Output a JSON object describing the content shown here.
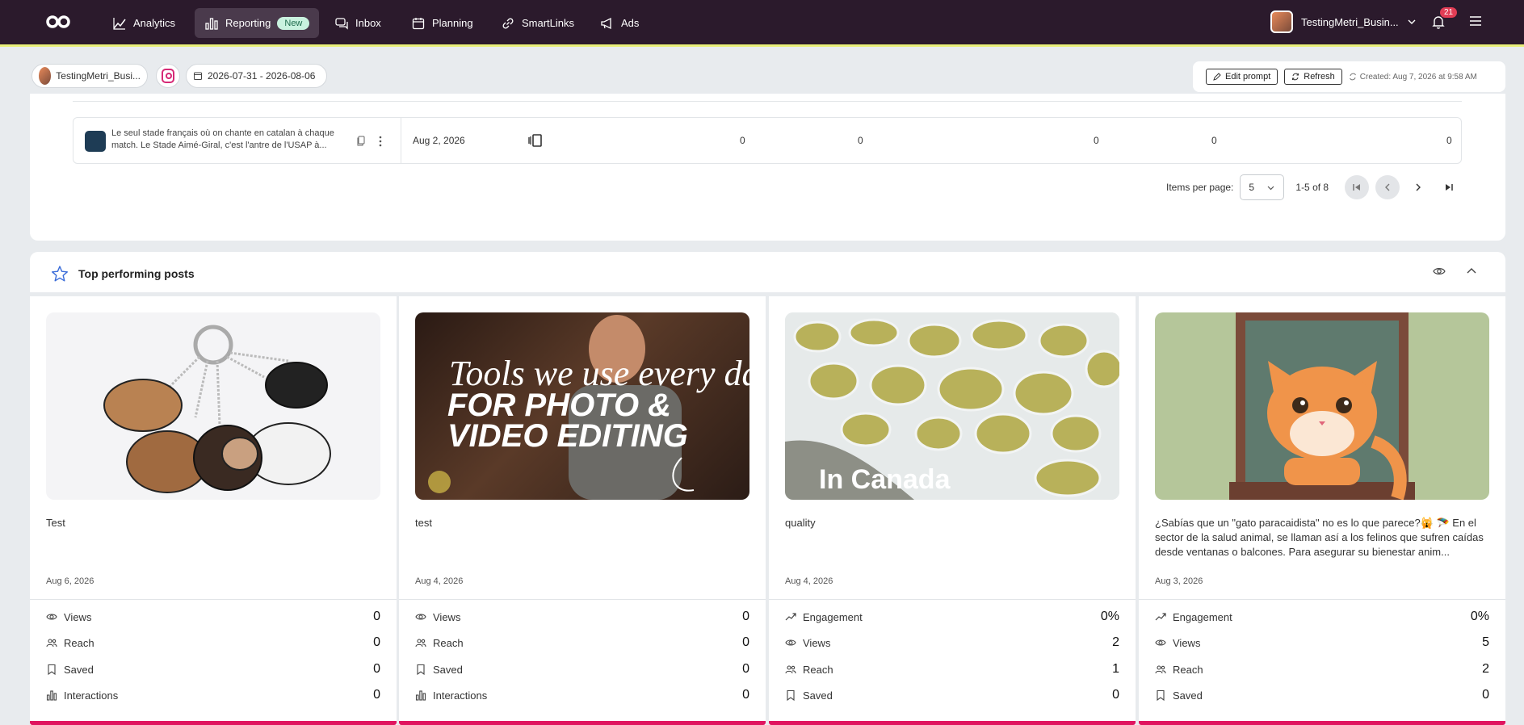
{
  "nav": {
    "items": [
      {
        "label": "Analytics"
      },
      {
        "label": "Reporting",
        "badge": "New"
      },
      {
        "label": "Inbox"
      },
      {
        "label": "Planning"
      },
      {
        "label": "SmartLinks"
      },
      {
        "label": "Ads"
      }
    ],
    "account_name": "TestingMetri_Busin...",
    "notifications": "21"
  },
  "filters": {
    "account": "TestingMetri_Busi...",
    "date_range": "2026-07-31 - 2026-08-06"
  },
  "actions": {
    "edit_prompt": "Edit prompt",
    "refresh": "Refresh",
    "created": "Created: Aug 7, 2026 at 9:58 AM"
  },
  "table": {
    "row": {
      "text": "Le seul stade français où on chante en catalan à chaque match. Le Stade Aimé-Giral, c'est l'antre de l'USAP à...",
      "date": "Aug 2, 2026",
      "values": [
        "0",
        "0",
        "0",
        "0",
        "0"
      ]
    },
    "pagination": {
      "items_per_page_label": "Items per page:",
      "items_per_page": "5",
      "range": "1-5 of 8"
    }
  },
  "top_posts": {
    "title": "Top performing posts",
    "cards": [
      {
        "caption": "Test",
        "date": "Aug 6, 2026",
        "metrics": [
          {
            "icon": "eye-icon",
            "label": "Views",
            "value": "0"
          },
          {
            "icon": "people-icon",
            "label": "Reach",
            "value": "0"
          },
          {
            "icon": "bookmark-icon",
            "label": "Saved",
            "value": "0"
          },
          {
            "icon": "bar-chart-icon",
            "label": "Interactions",
            "value": "0"
          }
        ]
      },
      {
        "caption": "test",
        "date": "Aug 4, 2026",
        "image_text_1": "Tools we use every day",
        "image_text_2": "FOR PHOTO &",
        "image_text_3": "VIDEO EDITING",
        "metrics": [
          {
            "icon": "eye-icon",
            "label": "Views",
            "value": "0"
          },
          {
            "icon": "people-icon",
            "label": "Reach",
            "value": "0"
          },
          {
            "icon": "bookmark-icon",
            "label": "Saved",
            "value": "0"
          },
          {
            "icon": "bar-chart-icon",
            "label": "Interactions",
            "value": "0"
          }
        ]
      },
      {
        "caption": "quality",
        "date": "Aug 4, 2026",
        "image_text": "In Canada",
        "metrics": [
          {
            "icon": "trend-icon",
            "label": "Engagement",
            "value": "0%"
          },
          {
            "icon": "eye-icon",
            "label": "Views",
            "value": "2"
          },
          {
            "icon": "people-icon",
            "label": "Reach",
            "value": "1"
          },
          {
            "icon": "bookmark-icon",
            "label": "Saved",
            "value": "0"
          }
        ]
      },
      {
        "caption": "¿Sabías que un \"gato paracaidista\" no es lo que parece?🙀 🪂 En el sector de la salud animal, se llaman así a los felinos que sufren caídas desde ventanas o balcones. Para asegurar su bienestar anim...",
        "date": "Aug 3, 2026",
        "metrics": [
          {
            "icon": "trend-icon",
            "label": "Engagement",
            "value": "0%"
          },
          {
            "icon": "eye-icon",
            "label": "Views",
            "value": "5"
          },
          {
            "icon": "people-icon",
            "label": "Reach",
            "value": "2"
          },
          {
            "icon": "bookmark-icon",
            "label": "Saved",
            "value": "0"
          }
        ]
      }
    ]
  },
  "colors": {
    "nav_bg": "#2b1a2c",
    "nav_accent": "#e9ef7a",
    "card_accent": "#e0145f"
  }
}
